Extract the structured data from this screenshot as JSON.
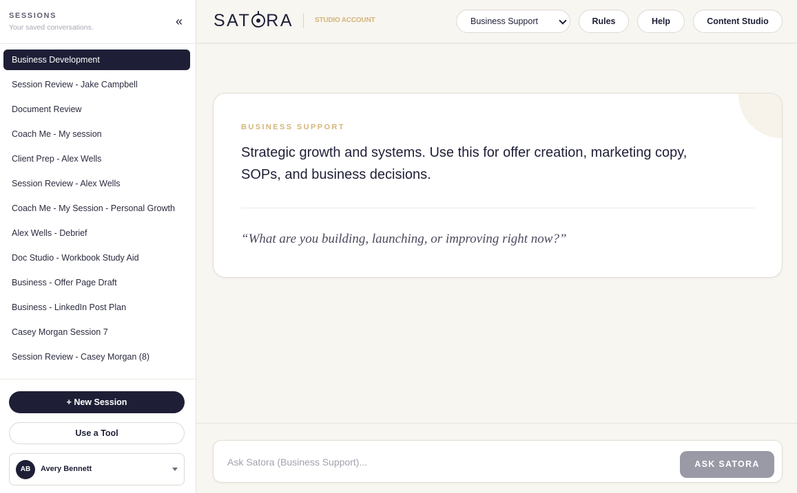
{
  "sidebar": {
    "title": "SESSIONS",
    "subtitle": "Your saved conversations.",
    "collapse_icon": "«",
    "sessions": [
      {
        "label": "Business Development",
        "active": true
      },
      {
        "label": "Session Review - Jake Campbell"
      },
      {
        "label": "Document Review"
      },
      {
        "label": "Coach Me - My session"
      },
      {
        "label": "Client Prep - Alex Wells"
      },
      {
        "label": "Session Review - Alex Wells"
      },
      {
        "label": "Coach Me - My Session - Personal Growth"
      },
      {
        "label": "Alex Wells - Debrief"
      },
      {
        "label": "Doc Studio - Workbook Study Aid"
      },
      {
        "label": "Business - Offer Page Draft"
      },
      {
        "label": "Business - LinkedIn Post Plan"
      },
      {
        "label": "Casey Morgan Session 7"
      },
      {
        "label": "Session Review - Casey Morgan (8)"
      }
    ],
    "new_session_label": "+ New Session",
    "tool_label": "Use a Tool",
    "user": {
      "initials": "AB",
      "name": "Avery Bennett"
    }
  },
  "header": {
    "brand": {
      "pre": "SAT",
      "post": "RA"
    },
    "account_tag": "STUDIO ACCOUNT",
    "mode_select": {
      "value": "Business Support"
    },
    "buttons": {
      "rules": "Rules",
      "help": "Help",
      "content_studio": "Content Studio"
    }
  },
  "mode_card": {
    "label": "BUSINESS SUPPORT",
    "description": "Strategic growth and systems. Use this for offer creation, marketing copy, SOPs, and business decisions.",
    "prompt": "“What are you building, launching, or improving right now?”"
  },
  "composer": {
    "placeholder": "Ask Satora (Business Support)...",
    "submit_label": "ASK SATORA"
  },
  "colors": {
    "navy": "#1e1f36",
    "gold": "#d4b57a",
    "background": "#f8f6f1",
    "disabled_button": "#999aa6"
  }
}
